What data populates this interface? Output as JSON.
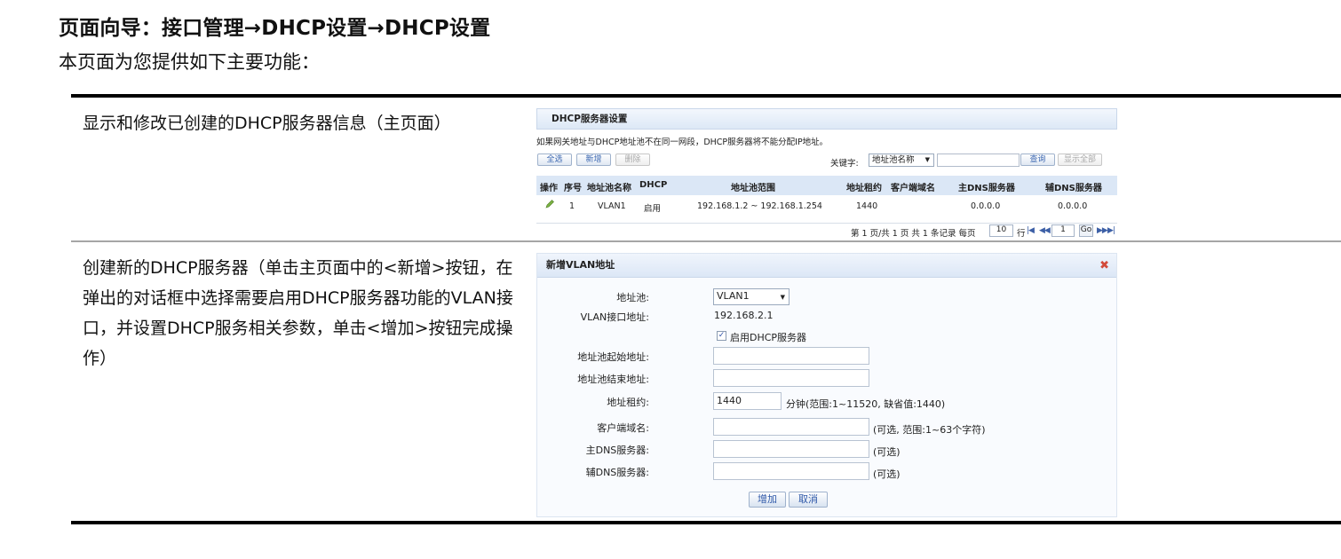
{
  "page": {
    "title": "页面向导：接口管理→DHCP设置→DHCP设置",
    "intro": "本页面为您提供如下主要功能："
  },
  "rows": [
    {
      "description": "显示和修改已创建的DHCP服务器信息（主页面）"
    },
    {
      "description": "创建新的DHCP服务器（单击主页面中的<新增>按钮，在弹出的对话框中选择需要启用DHCP服务器功能的VLAN接口，并设置DHCP服务相关参数，单击<增加>按钮完成操作）"
    }
  ],
  "dhcp_list": {
    "header": "DHCP服务器设置",
    "note": "如果网关地址与DHCP地址池不在同一网段，DHCP服务器将不能分配IP地址。",
    "buttons": {
      "select_all": "全选",
      "add": "新增",
      "delete": "删除",
      "search": "查询",
      "show_all": "显示全部"
    },
    "keyword_label": "关键字:",
    "keyword_select": "地址池名称",
    "columns": [
      "操作",
      "序号",
      "地址池名称",
      "DHCP",
      "地址池范围",
      "地址租约",
      "客户端域名",
      "主DNS服务器",
      "辅DNS服务器"
    ],
    "rows": [
      {
        "index": "1",
        "pool": "VLAN1",
        "dhcp": "启用",
        "range": "192.168.1.2 ~ 192.168.1.254",
        "lease": "1440",
        "domain": "",
        "dns1": "0.0.0.0",
        "dns2": "0.0.0.0"
      }
    ],
    "pager": {
      "summary": "第 1 页/共 1 页 共 1 条记录 每页",
      "per_page": "10",
      "row_unit": "行",
      "page": "1",
      "go": "Go"
    }
  },
  "add_dialog": {
    "header": "新增VLAN地址",
    "fields": {
      "pool_label": "地址池:",
      "pool_value": "VLAN1",
      "vlan_ip_label": "VLAN接口地址:",
      "vlan_ip_value": "192.168.2.1",
      "enable_label": "启用DHCP服务器",
      "start_label": "地址池起始地址:",
      "end_label": "地址池结束地址:",
      "lease_label": "地址租约:",
      "lease_value": "1440",
      "lease_hint": "分钟(范围:1~11520, 缺省值:1440)",
      "domain_label": "客户端域名:",
      "domain_hint": "(可选, 范围:1~63个字符)",
      "dns1_label": "主DNS服务器:",
      "dns1_hint": "(可选)",
      "dns2_label": "辅DNS服务器:",
      "dns2_hint": "(可选)"
    },
    "buttons": {
      "add": "增加",
      "cancel": "取消"
    }
  }
}
